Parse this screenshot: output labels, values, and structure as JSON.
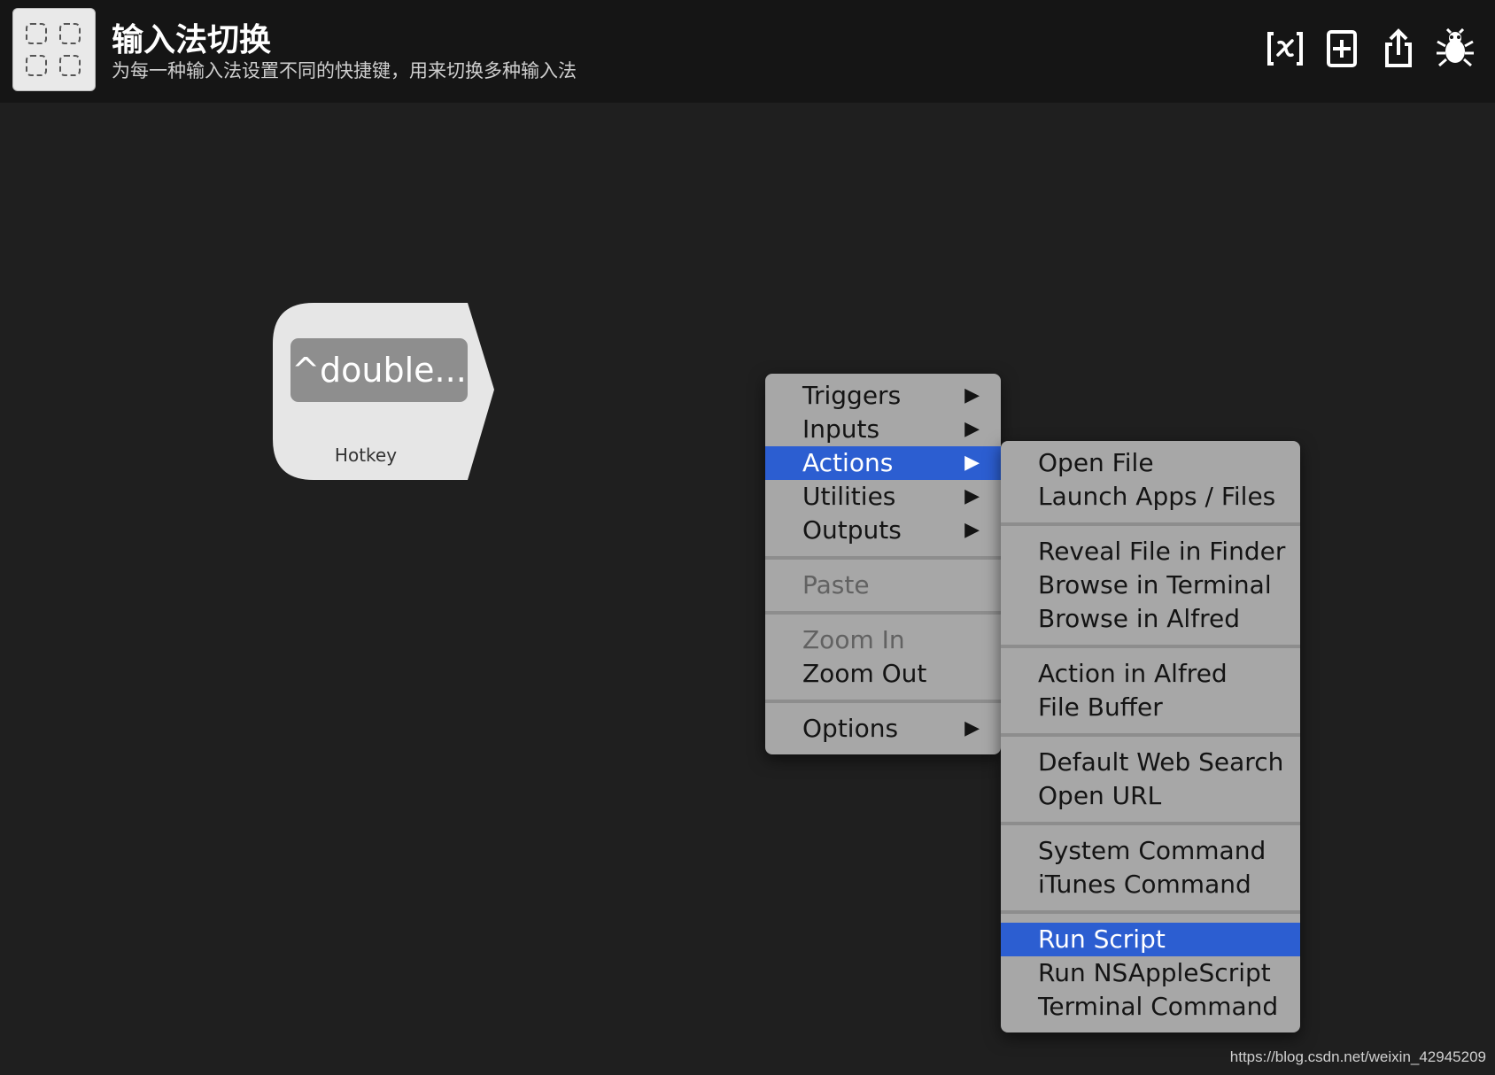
{
  "header": {
    "title": "输入法切换",
    "description": "为每一种输入法设置不同的快捷键，用来切换多种输入法",
    "toolbar": [
      {
        "name": "variables-icon"
      },
      {
        "name": "add-object-icon"
      },
      {
        "name": "share-icon"
      },
      {
        "name": "debug-bug-icon"
      }
    ]
  },
  "node": {
    "key_text": "^double...",
    "type_label": "Hotkey"
  },
  "context_menu": {
    "items": [
      {
        "label": "Triggers",
        "submenu": true,
        "enabled": true
      },
      {
        "label": "Inputs",
        "submenu": true,
        "enabled": true
      },
      {
        "label": "Actions",
        "submenu": true,
        "enabled": true,
        "highlighted": true
      },
      {
        "label": "Utilities",
        "submenu": true,
        "enabled": true
      },
      {
        "label": "Outputs",
        "submenu": true,
        "enabled": true
      },
      {
        "label": "Paste",
        "enabled": false
      },
      {
        "label": "Zoom In",
        "enabled": false
      },
      {
        "label": "Zoom Out",
        "enabled": true
      },
      {
        "label": "Options",
        "submenu": true,
        "enabled": true
      }
    ],
    "submenu_arrow": "▶"
  },
  "actions_submenu": {
    "groups": [
      [
        "Open File",
        "Launch Apps / Files"
      ],
      [
        "Reveal File in Finder",
        "Browse in Terminal",
        "Browse in Alfred"
      ],
      [
        "Action in Alfred",
        "File Buffer"
      ],
      [
        "Default Web Search",
        "Open URL"
      ],
      [
        "System Command",
        "iTunes Command"
      ],
      [
        "Run Script",
        "Run NSAppleScript",
        "Terminal Command"
      ]
    ],
    "highlighted": "Run Script"
  },
  "footer": {
    "url": "https://blog.csdn.net/weixin_42945209"
  },
  "colors": {
    "highlight": "#2c5ed1",
    "menu_bg": "#a7a7a7",
    "canvas_bg": "#1f1f1f",
    "header_bg": "#151515"
  }
}
